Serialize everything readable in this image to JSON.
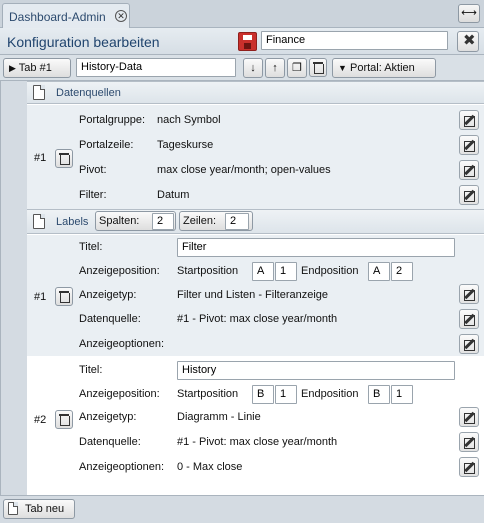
{
  "window": {
    "tab_title": "Dashboard-Admin"
  },
  "header": {
    "title": "Konfiguration bearbeiten",
    "dashboard_name": "Finance"
  },
  "toolbar": {
    "tab_button": "Tab #1",
    "tab_name": "History-Data",
    "portal_button": "Portal: Aktien"
  },
  "datasources": {
    "title": "Datenquellen",
    "items": [
      {
        "index": "#1",
        "rows": [
          {
            "label": "Portalgruppe:",
            "value": "nach Symbol"
          },
          {
            "label": "Portalzeile:",
            "value": "Tageskurse"
          },
          {
            "label": "Pivot:",
            "value": "max close year/month; open-values"
          },
          {
            "label": "Filter:",
            "value": "Datum"
          }
        ]
      }
    ]
  },
  "labels": {
    "title": "Labels",
    "columns_label": "Spalten:",
    "columns_value": "2",
    "rows_label": "Zeilen:",
    "rows_value": "2",
    "items": [
      {
        "index": "#1",
        "title_label": "Titel:",
        "title_value": "Filter",
        "position_label": "Anzeigeposition:",
        "start_label": "Startposition",
        "start_col": "A",
        "start_row": "1",
        "end_label": "Endposition",
        "end_col": "A",
        "end_row": "2",
        "type_label": "Anzeigetyp:",
        "type_value": "Filter und Listen - Filteranzeige",
        "source_label": "Datenquelle:",
        "source_value": "#1 - Pivot: max close year/month",
        "options_label": "Anzeigeoptionen:",
        "options_value": ""
      },
      {
        "index": "#2",
        "title_label": "Titel:",
        "title_value": "History",
        "position_label": "Anzeigeposition:",
        "start_label": "Startposition",
        "start_col": "B",
        "start_row": "1",
        "end_label": "Endposition",
        "end_col": "B",
        "end_row": "1",
        "type_label": "Anzeigetyp:",
        "type_value": "Diagramm - Linie",
        "source_label": "Datenquelle:",
        "source_value": "#1 - Pivot: max close year/month",
        "options_label": "Anzeigeoptionen:",
        "options_value": "0 - Max close"
      }
    ]
  },
  "footer": {
    "new_tab_button": "Tab neu"
  }
}
